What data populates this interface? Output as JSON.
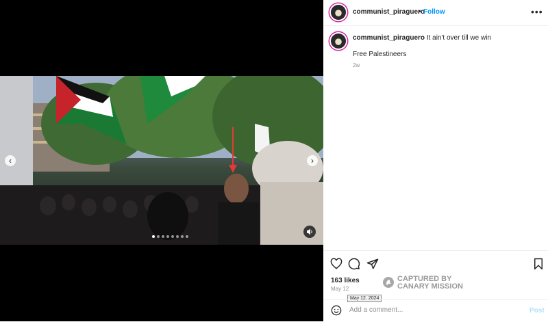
{
  "post": {
    "username": "communist_piraguero",
    "follow_label": "Follow",
    "separator": "•",
    "more_label": "•••",
    "caption_text": "It ain't over till we win",
    "caption_line2": "Free Palestineers",
    "caption_time": "2w"
  },
  "media": {
    "prev_label": "‹",
    "next_label": "›",
    "dot_count": 8,
    "active_dot": 0
  },
  "engagement": {
    "likes": "163 likes",
    "date": "May 12",
    "date_tooltip": "May 12, 2024"
  },
  "watermark": {
    "line1": "CAPTURED BY",
    "line2": "CANARY MISSION"
  },
  "comment": {
    "placeholder": "Add a comment...",
    "post_label": "Post"
  },
  "icons": [
    "heart-icon",
    "comment-icon",
    "share-icon",
    "bookmark-icon",
    "emoji-icon",
    "mute-icon",
    "chevron-left-icon",
    "chevron-right-icon"
  ],
  "colors": {
    "follow": "#0095f6",
    "post": "#b2dffc",
    "story_ring": "#d6249f",
    "arrow": "#e53935"
  }
}
